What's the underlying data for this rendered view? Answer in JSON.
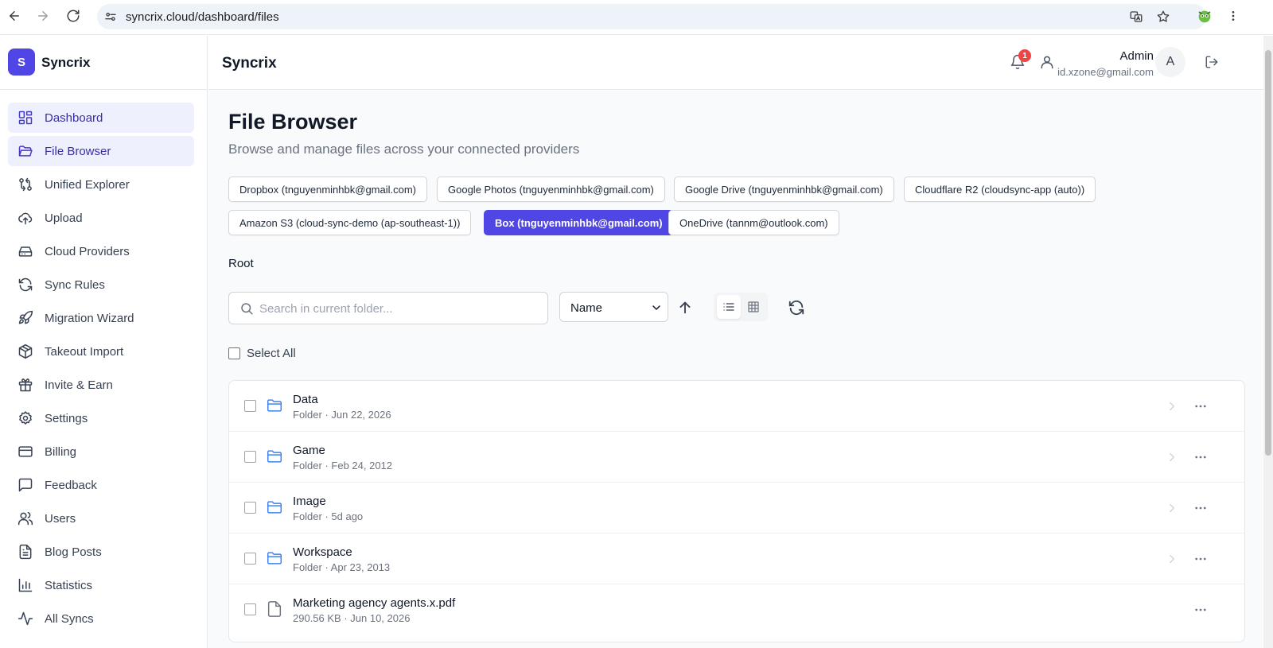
{
  "browser": {
    "url": "syncrix.cloud/dashboard/files"
  },
  "brand": {
    "logo_letter": "S",
    "name": "Syncrix"
  },
  "sidebar": {
    "items": [
      {
        "label": "Dashboard",
        "icon": "dashboard-icon",
        "active": true
      },
      {
        "label": "File Browser",
        "icon": "folder-open-icon",
        "active": true
      },
      {
        "label": "Unified Explorer",
        "icon": "explorer-icon"
      },
      {
        "label": "Upload",
        "icon": "upload-cloud-icon"
      },
      {
        "label": "Cloud Providers",
        "icon": "hard-drive-icon"
      },
      {
        "label": "Sync Rules",
        "icon": "refresh-icon"
      },
      {
        "label": "Migration Wizard",
        "icon": "rocket-icon"
      },
      {
        "label": "Takeout Import",
        "icon": "package-icon"
      },
      {
        "label": "Invite & Earn",
        "icon": "gift-icon"
      },
      {
        "label": "Settings",
        "icon": "gear-icon"
      },
      {
        "label": "Billing",
        "icon": "credit-card-icon"
      },
      {
        "label": "Feedback",
        "icon": "message-square-icon"
      },
      {
        "label": "Users",
        "icon": "users-icon"
      },
      {
        "label": "Blog Posts",
        "icon": "document-icon"
      },
      {
        "label": "Statistics",
        "icon": "bar-chart-icon"
      },
      {
        "label": "All Syncs",
        "icon": "activity-icon"
      }
    ]
  },
  "header": {
    "title": "Syncrix",
    "notification_count": "1",
    "user_name": "Admin",
    "user_email": "id.xzone@gmail.com",
    "avatar_letter": "A"
  },
  "main": {
    "title": "File Browser",
    "subtitle": "Browse and manage files across your connected providers",
    "providers": [
      {
        "label": "Dropbox (tnguyenminhbk@gmail.com)",
        "active": false
      },
      {
        "label": "Google Photos (tnguyenminhbk@gmail.com)",
        "active": false
      },
      {
        "label": "Google Drive (tnguyenminhbk@gmail.com)",
        "active": false
      },
      {
        "label": "Cloudflare R2 (cloudsync-app (auto))",
        "active": false
      },
      {
        "label": "Amazon S3 (cloud-sync-demo (ap-southeast-1))",
        "active": false
      },
      {
        "label": "Box (tnguyenminhbk@gmail.com)",
        "active": true
      },
      {
        "label": "OneDrive (tannm@outlook.com)",
        "active": false
      }
    ],
    "breadcrumb": "Root",
    "search_placeholder": "Search in current folder...",
    "sort_value": "Name",
    "select_all_label": "Select All",
    "files": [
      {
        "name": "Data",
        "meta": "Folder · Jun 22, 2026",
        "type": "folder"
      },
      {
        "name": "Game",
        "meta": "Folder · Feb 24, 2012",
        "type": "folder"
      },
      {
        "name": "Image",
        "meta": "Folder · 5d ago",
        "type": "folder"
      },
      {
        "name": "Workspace",
        "meta": "Folder · Apr 23, 2013",
        "type": "folder"
      },
      {
        "name": "Marketing agency agents.x.pdf",
        "meta": "290.56 KB · Jun 10, 2026",
        "type": "file"
      }
    ]
  },
  "colors": {
    "accent": "#4f46e5",
    "folder": "#3b82f6",
    "badge": "#ef4444"
  }
}
